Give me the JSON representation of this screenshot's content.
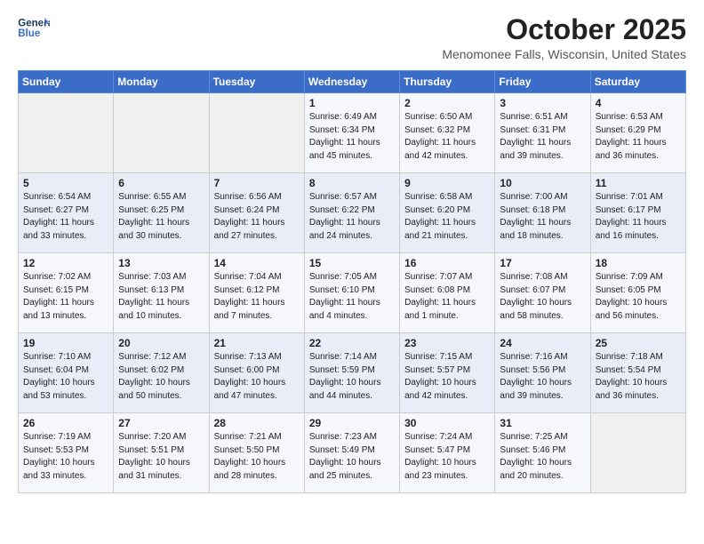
{
  "header": {
    "logo_line1": "General",
    "logo_line2": "Blue",
    "month_title": "October 2025",
    "location": "Menomonee Falls, Wisconsin, United States"
  },
  "weekdays": [
    "Sunday",
    "Monday",
    "Tuesday",
    "Wednesday",
    "Thursday",
    "Friday",
    "Saturday"
  ],
  "weeks": [
    [
      {
        "day": "",
        "info": ""
      },
      {
        "day": "",
        "info": ""
      },
      {
        "day": "",
        "info": ""
      },
      {
        "day": "1",
        "info": "Sunrise: 6:49 AM\nSunset: 6:34 PM\nDaylight: 11 hours\nand 45 minutes."
      },
      {
        "day": "2",
        "info": "Sunrise: 6:50 AM\nSunset: 6:32 PM\nDaylight: 11 hours\nand 42 minutes."
      },
      {
        "day": "3",
        "info": "Sunrise: 6:51 AM\nSunset: 6:31 PM\nDaylight: 11 hours\nand 39 minutes."
      },
      {
        "day": "4",
        "info": "Sunrise: 6:53 AM\nSunset: 6:29 PM\nDaylight: 11 hours\nand 36 minutes."
      }
    ],
    [
      {
        "day": "5",
        "info": "Sunrise: 6:54 AM\nSunset: 6:27 PM\nDaylight: 11 hours\nand 33 minutes."
      },
      {
        "day": "6",
        "info": "Sunrise: 6:55 AM\nSunset: 6:25 PM\nDaylight: 11 hours\nand 30 minutes."
      },
      {
        "day": "7",
        "info": "Sunrise: 6:56 AM\nSunset: 6:24 PM\nDaylight: 11 hours\nand 27 minutes."
      },
      {
        "day": "8",
        "info": "Sunrise: 6:57 AM\nSunset: 6:22 PM\nDaylight: 11 hours\nand 24 minutes."
      },
      {
        "day": "9",
        "info": "Sunrise: 6:58 AM\nSunset: 6:20 PM\nDaylight: 11 hours\nand 21 minutes."
      },
      {
        "day": "10",
        "info": "Sunrise: 7:00 AM\nSunset: 6:18 PM\nDaylight: 11 hours\nand 18 minutes."
      },
      {
        "day": "11",
        "info": "Sunrise: 7:01 AM\nSunset: 6:17 PM\nDaylight: 11 hours\nand 16 minutes."
      }
    ],
    [
      {
        "day": "12",
        "info": "Sunrise: 7:02 AM\nSunset: 6:15 PM\nDaylight: 11 hours\nand 13 minutes."
      },
      {
        "day": "13",
        "info": "Sunrise: 7:03 AM\nSunset: 6:13 PM\nDaylight: 11 hours\nand 10 minutes."
      },
      {
        "day": "14",
        "info": "Sunrise: 7:04 AM\nSunset: 6:12 PM\nDaylight: 11 hours\nand 7 minutes."
      },
      {
        "day": "15",
        "info": "Sunrise: 7:05 AM\nSunset: 6:10 PM\nDaylight: 11 hours\nand 4 minutes."
      },
      {
        "day": "16",
        "info": "Sunrise: 7:07 AM\nSunset: 6:08 PM\nDaylight: 11 hours\nand 1 minute."
      },
      {
        "day": "17",
        "info": "Sunrise: 7:08 AM\nSunset: 6:07 PM\nDaylight: 10 hours\nand 58 minutes."
      },
      {
        "day": "18",
        "info": "Sunrise: 7:09 AM\nSunset: 6:05 PM\nDaylight: 10 hours\nand 56 minutes."
      }
    ],
    [
      {
        "day": "19",
        "info": "Sunrise: 7:10 AM\nSunset: 6:04 PM\nDaylight: 10 hours\nand 53 minutes."
      },
      {
        "day": "20",
        "info": "Sunrise: 7:12 AM\nSunset: 6:02 PM\nDaylight: 10 hours\nand 50 minutes."
      },
      {
        "day": "21",
        "info": "Sunrise: 7:13 AM\nSunset: 6:00 PM\nDaylight: 10 hours\nand 47 minutes."
      },
      {
        "day": "22",
        "info": "Sunrise: 7:14 AM\nSunset: 5:59 PM\nDaylight: 10 hours\nand 44 minutes."
      },
      {
        "day": "23",
        "info": "Sunrise: 7:15 AM\nSunset: 5:57 PM\nDaylight: 10 hours\nand 42 minutes."
      },
      {
        "day": "24",
        "info": "Sunrise: 7:16 AM\nSunset: 5:56 PM\nDaylight: 10 hours\nand 39 minutes."
      },
      {
        "day": "25",
        "info": "Sunrise: 7:18 AM\nSunset: 5:54 PM\nDaylight: 10 hours\nand 36 minutes."
      }
    ],
    [
      {
        "day": "26",
        "info": "Sunrise: 7:19 AM\nSunset: 5:53 PM\nDaylight: 10 hours\nand 33 minutes."
      },
      {
        "day": "27",
        "info": "Sunrise: 7:20 AM\nSunset: 5:51 PM\nDaylight: 10 hours\nand 31 minutes."
      },
      {
        "day": "28",
        "info": "Sunrise: 7:21 AM\nSunset: 5:50 PM\nDaylight: 10 hours\nand 28 minutes."
      },
      {
        "day": "29",
        "info": "Sunrise: 7:23 AM\nSunset: 5:49 PM\nDaylight: 10 hours\nand 25 minutes."
      },
      {
        "day": "30",
        "info": "Sunrise: 7:24 AM\nSunset: 5:47 PM\nDaylight: 10 hours\nand 23 minutes."
      },
      {
        "day": "31",
        "info": "Sunrise: 7:25 AM\nSunset: 5:46 PM\nDaylight: 10 hours\nand 20 minutes."
      },
      {
        "day": "",
        "info": ""
      }
    ]
  ]
}
